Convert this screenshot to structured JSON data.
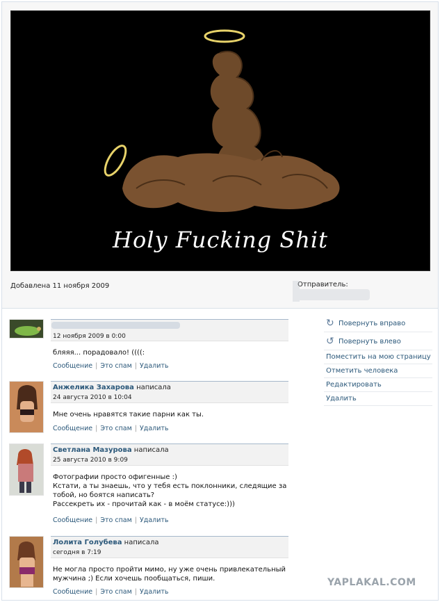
{
  "photo": {
    "caption": "Holy Fucking Shit",
    "added_label": "Добавлена 11 ноября 2009",
    "sender_label": "Отправитель:"
  },
  "comments": [
    {
      "author": "",
      "wrote": "",
      "date": "12 ноября 2009 в 0:00",
      "text": [
        "бляяя... порадовало! ((((:"
      ],
      "actions": [
        "Сообщение",
        "Это спам",
        "Удалить"
      ]
    },
    {
      "author": "Анжелика Захарова",
      "wrote": "написала",
      "date": "24 августа 2010 в 10:04",
      "text": [
        "Мне очень нравятся такие парни как ты."
      ],
      "actions": [
        "Сообщение",
        "Это спам",
        "Удалить"
      ]
    },
    {
      "author": "Светлана Мазурова",
      "wrote": "написала",
      "date": "25 августа 2010 в 9:09",
      "text": [
        "Фотографии просто офигенные :)",
        "Кстати, а ты знаешь, что у тебя есть поклонники, следящие за",
        "тобой, но боятся написать?",
        "Рассекреть их - прочитай как - в моём статусе:)))"
      ],
      "actions": [
        "Сообщение",
        "Это спам",
        "Удалить"
      ]
    },
    {
      "author": "Лолита Голубева",
      "wrote": "написала",
      "date": "сегодня в 7:19",
      "text": [
        "Не могла просто пройти мимо, ну уже очень привлекательный",
        "мужчина ;) Если хочешь пообщаться, пиши."
      ],
      "actions": [
        "Сообщение",
        "Это спам",
        "Удалить"
      ]
    }
  ],
  "menu": {
    "rotate_right": "Повернуть вправо",
    "rotate_left": "Повернуть влево",
    "put_on_page": "Поместить на мою страницу",
    "tag_person": "Отметить человека",
    "edit": "Редактировать",
    "delete": "Удалить"
  },
  "watermark": "YAPLAKAL.COM",
  "colors": {
    "link": "#2b587a",
    "header_bg": "#f2f2f2",
    "header_border": "#a5b7ca"
  }
}
